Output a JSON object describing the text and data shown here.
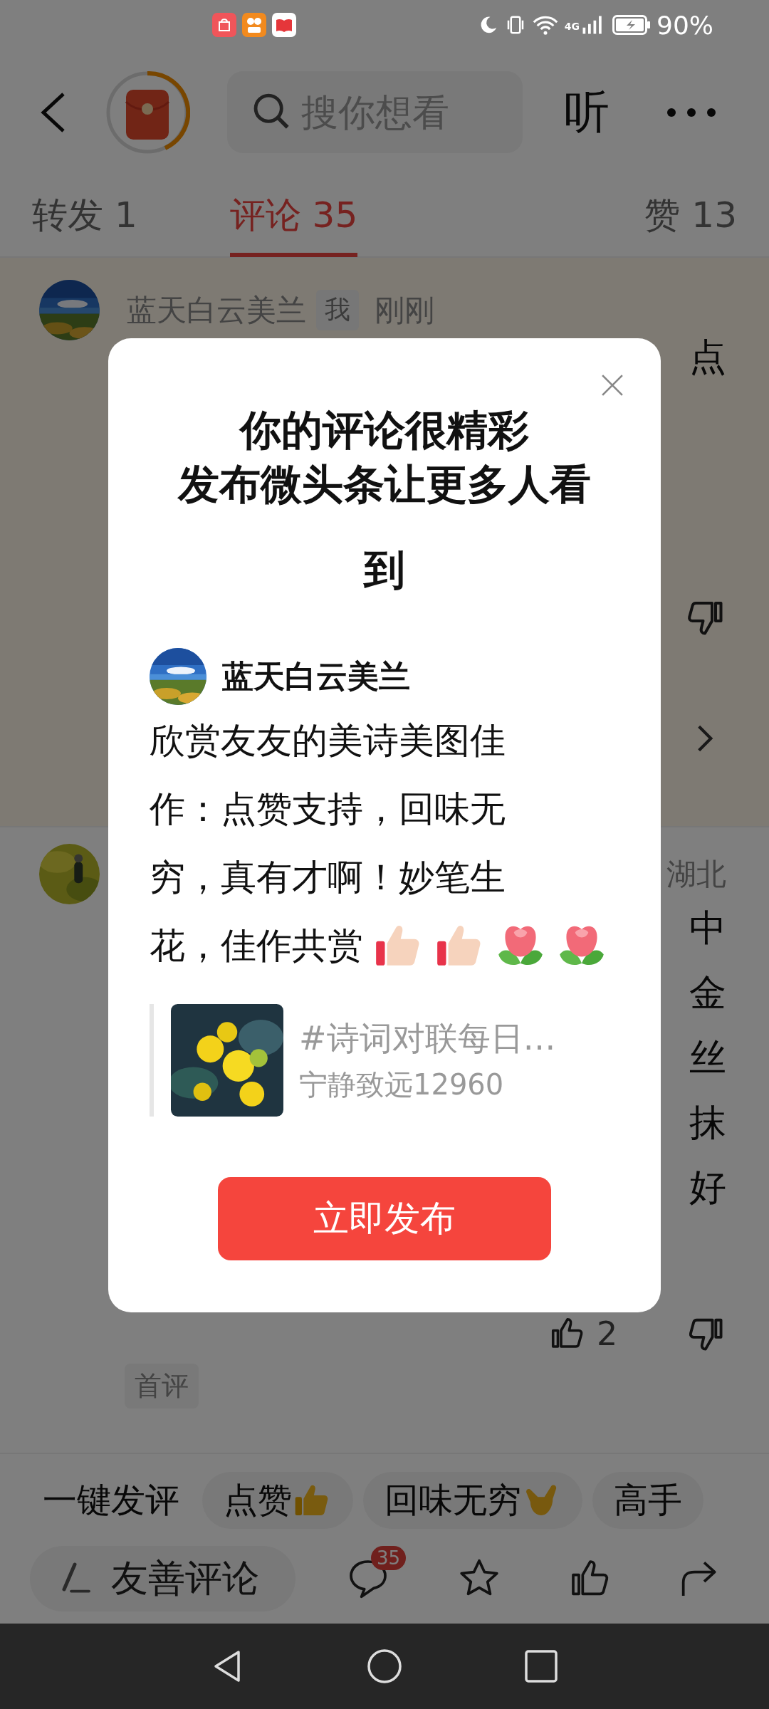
{
  "status_bar": {
    "network": "4G",
    "battery": "90%"
  },
  "header": {
    "search": {
      "placeholder": "搜你想看"
    },
    "listen": "听"
  },
  "tabs": [
    {
      "label": "转发 1",
      "selected": false
    },
    {
      "label": "评论 35",
      "selected": true
    },
    {
      "label": "赞 13",
      "selected": false
    }
  ],
  "comments": [
    {
      "author": "蓝天白云美兰",
      "tag": "我",
      "time": "刚刚",
      "text_fragments": [
        "点"
      ],
      "highlighted": true
    },
    {
      "location": "湖北",
      "text_fragments": [
        "中",
        "金",
        "丝",
        "抹",
        "好"
      ],
      "likes": "2",
      "badge": "首评",
      "highlighted": false
    }
  ],
  "dialog": {
    "title": "你的评论很精彩",
    "subtitle": "发布微头条让更多人看到",
    "author": "蓝天白云美兰",
    "text_lines": [
      "欣赏友友的美诗美图佳",
      "作：点赞支持，回味无",
      "穷，真有才啊！妙笔生",
      "花，佳作共赏"
    ],
    "emojis": [
      {
        "kind": "thumbs_up"
      },
      {
        "kind": "thumbs_up"
      },
      {
        "kind": "flower"
      },
      {
        "kind": "flower"
      }
    ],
    "quote": {
      "title": "#诗词对联每日…",
      "author": "宁静致远12960"
    },
    "button": "立即发布"
  },
  "quick_replies": {
    "label": "一键发评",
    "chips": [
      {
        "text": "点赞",
        "emoji": {
          "kind": "thumbs_up"
        }
      },
      {
        "text": "回味无穷",
        "emoji": {
          "kind": "hand"
        }
      },
      {
        "text": "高手"
      }
    ]
  },
  "bottom_bar": {
    "input_placeholder": "友善评论",
    "comment_count": "35"
  }
}
